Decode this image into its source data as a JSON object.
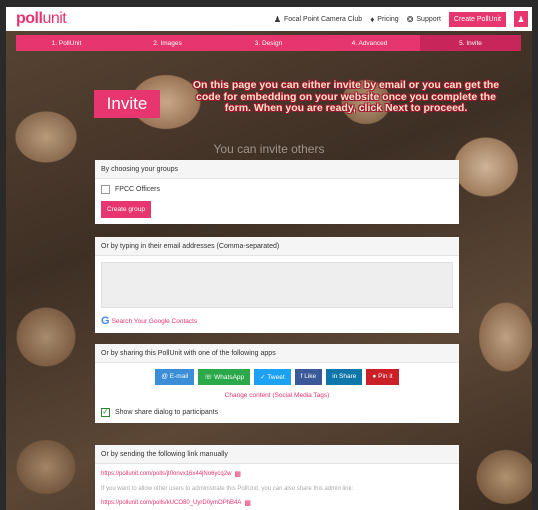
{
  "app": {
    "logo_bold": "poll",
    "logo_thin": "unit"
  },
  "topnav": {
    "account": "Focal Point Camera Club",
    "pricing": "Pricing",
    "support": "Support",
    "create": "Create PollUnit"
  },
  "steps": [
    "1. PollUnit",
    "2. Images",
    "3. Design",
    "4. Advanced",
    "5. Invite"
  ],
  "page": {
    "title": "Invite",
    "notice": "On this page you can either invite by email or you can get the code for embedding on your website once you complete the form. When you are ready, click Next to proceed.",
    "subhead": "You can invite others"
  },
  "groups": {
    "header": "By choosing your groups",
    "option": "FPCC Officers",
    "button": "Create group"
  },
  "email": {
    "header": "Or by typing in their email addresses (Comma-separated)",
    "value": "",
    "google_link": "Search Your Google Contacts"
  },
  "apps": {
    "header": "Or by sharing this PollUnit with one of the following apps",
    "buttons": [
      {
        "label": "@ E-mail",
        "color": "#3b8dd6"
      },
      {
        "label": "WhatsApp",
        "color": "#2aa84a"
      },
      {
        "label": "Tweet",
        "color": "#1da1f2"
      },
      {
        "label": "f Like",
        "color": "#3b5998"
      },
      {
        "label": "in Share",
        "color": "#0e76a8"
      },
      {
        "label": "Pin it",
        "color": "#cb2027"
      }
    ],
    "change_content": "Change content (Social Media Tags)",
    "show_dialog": "Show share dialog to participants"
  },
  "link": {
    "header": "Or by sending the following link manually",
    "url": "https://pollunit.com/polls/jt0onvx16x44jNo6ycq2w",
    "admin_note": "If you want to allow other users to administrate this PollUnit, you can also share this admin link:",
    "admin_url": "https://pollunit.com/polls/kUCO80_UyrD0ymOPhB4A"
  },
  "colors": {
    "accent": "#e6356f"
  }
}
